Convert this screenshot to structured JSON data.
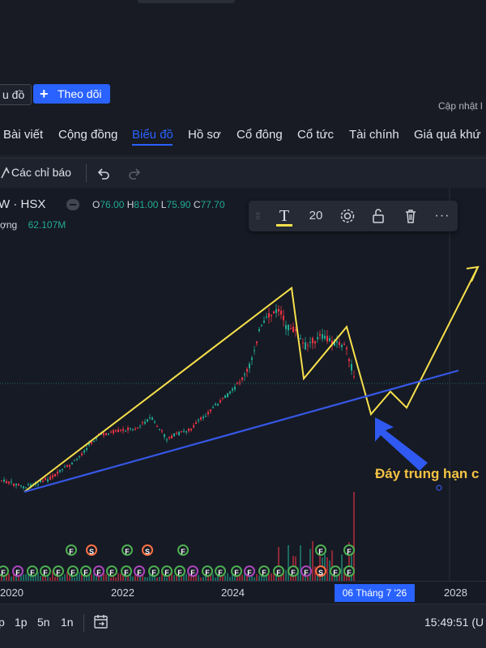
{
  "header": {
    "compare_button": "u đồ",
    "follow_button": "Theo dõi",
    "updated_label": "Cập nhật l"
  },
  "tabs": [
    "Bài viết",
    "Cộng đồng",
    "Biểu đồ",
    "Hồ sơ",
    "Cổ đông",
    "Cổ tức",
    "Tài chính",
    "Giá quá khứ"
  ],
  "active_tab": "Biểu đồ",
  "toolbar": {
    "indicators_label": "Các chỉ báo"
  },
  "legend": {
    "symbol": "W · HSX",
    "open_key": "O",
    "open": "76.00",
    "high_key": "H",
    "high": "81.00",
    "low_key": "L",
    "low": "75.90",
    "close_key": "C",
    "close": "77.70",
    "volume_label": "ợng",
    "volume": "62.107M"
  },
  "drawing_toolbar": {
    "font_size": "20",
    "text_icon": "text-icon",
    "settings_icon": "gear-icon",
    "lock_icon": "unlock-icon",
    "delete_icon": "trash-icon",
    "more_icon": "more-icon"
  },
  "annotation": {
    "text": "Đáy trung hạn c",
    "color": "#f6c343"
  },
  "x_axis": {
    "ticks": [
      "2020",
      "2022",
      "2024",
      "2028"
    ],
    "crosshair_date": "06 Tháng 7 '26"
  },
  "bottom_bar": {
    "ranges": [
      "p",
      "1p",
      "5n",
      "1n"
    ],
    "time": "15:49:51 (U"
  },
  "colors": {
    "accent": "#2962ff",
    "up": "#22ab94",
    "down": "#f23645",
    "trend_yellow": "#f6e04b",
    "trend_blue": "#3658e6"
  }
}
